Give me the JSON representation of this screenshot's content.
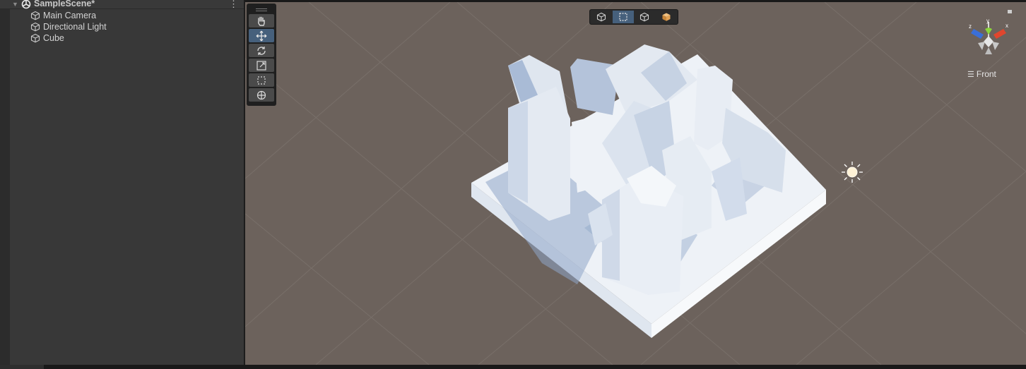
{
  "hierarchy": {
    "scene_name": "SampleScene*",
    "menu_icon": "kebab-icon",
    "items": [
      {
        "label": "Main Camera",
        "icon": "gameobject-cube-icon"
      },
      {
        "label": "Directional Light",
        "icon": "gameobject-cube-icon"
      },
      {
        "label": "Cube",
        "icon": "gameobject-cube-icon"
      }
    ]
  },
  "scene_view": {
    "tools": [
      "hand-tool",
      "move-tool",
      "rotate-tool",
      "scale-tool",
      "rect-tool",
      "transform-tool"
    ],
    "active_tool": "move-tool",
    "draw_modes": [
      "cube-icon",
      "rect-icon",
      "wire-cube-icon",
      "shaded-cube-icon"
    ],
    "active_draw_mode": "rect-icon",
    "orientation_label": "Front",
    "gizmo_axes": {
      "x": "x",
      "y": "y",
      "z": "z"
    }
  },
  "colors": {
    "panel_bg": "#383838",
    "scene_bg": "#6c625c",
    "active_blue": "#46607c",
    "axis_x": "#e0462e",
    "axis_y": "#8bd63b",
    "axis_z": "#3a6fd8"
  }
}
